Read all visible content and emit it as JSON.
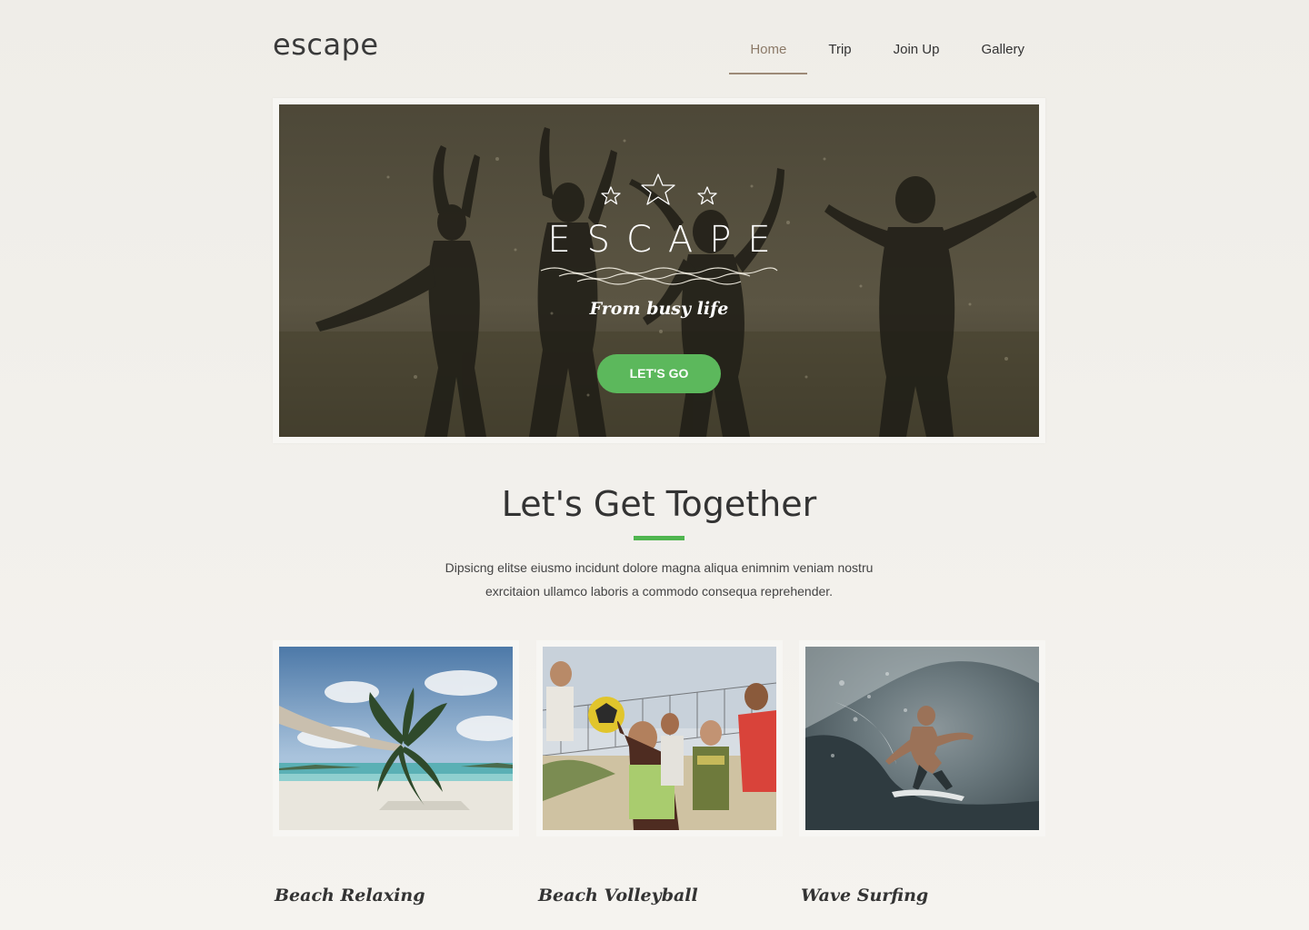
{
  "header": {
    "logo": "escape",
    "nav": [
      {
        "label": "Home",
        "active": true
      },
      {
        "label": "Trip",
        "active": false
      },
      {
        "label": "Join Up",
        "active": false
      },
      {
        "label": "Gallery",
        "active": false
      }
    ]
  },
  "hero": {
    "title": "ESCAPE",
    "subtitle": "From busy life",
    "button_label": "LET'S GO",
    "icons": [
      "star-icon",
      "star-icon",
      "star-icon",
      "wave-divider-icon"
    ]
  },
  "intro": {
    "title": "Let's Get Together",
    "text_line1": "Dipsicng elitse eiusmo incidunt dolore magna aliqua enimnim veniam nostru",
    "text_line2": "exrcitaion ullamco laboris a commodo consequa reprehender."
  },
  "cards": [
    {
      "label": "Beach Relaxing"
    },
    {
      "label": "Beach Volleyball"
    },
    {
      "label": "Wave Surfing"
    }
  ],
  "colors": {
    "accent_green": "#5cb85c",
    "nav_active": "#8c7a68",
    "background": "#efede8"
  }
}
